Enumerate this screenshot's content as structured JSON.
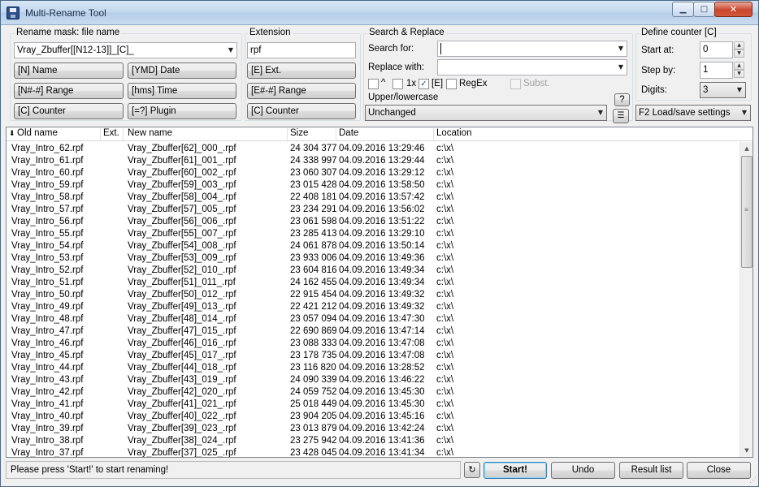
{
  "window": {
    "title": "Multi-Rename Tool"
  },
  "rename_mask": {
    "label": "Rename mask: file name",
    "value": "Vray_Zbuffer[[N12-13]]_[C]_",
    "buttons": [
      "[N]  Name",
      "[YMD]  Date",
      "[N#-#]  Range",
      "[hms]  Time",
      "[C]  Counter",
      "[=?]  Plugin"
    ]
  },
  "extension": {
    "label": "Extension",
    "value": "rpf",
    "buttons": [
      "[E]  Ext.",
      "[E#-#]  Range",
      "[C]  Counter"
    ]
  },
  "search_replace": {
    "label": "Search & Replace",
    "search_label": "Search for:",
    "search_value": "",
    "replace_label": "Replace with:",
    "replace_value": "",
    "opt_caret": "^",
    "opt_1x": "1x",
    "opt_e": "[E]",
    "opt_regex": "RegEx",
    "opt_subst": "Subst.",
    "case_label": "Upper/lowercase",
    "case_value": "Unchanged",
    "help_label": "?"
  },
  "counter": {
    "label": "Define counter [C]",
    "start_label": "Start at:",
    "start_value": "0",
    "step_label": "Step by:",
    "step_value": "1",
    "digits_label": "Digits:",
    "digits_value": "3",
    "load_save_label": "F2 Load/save settings"
  },
  "columns": [
    "Old name",
    "Ext.",
    "New name",
    "Size",
    "Date",
    "Location"
  ],
  "files": [
    {
      "old": "Vray_Intro_62.rpf",
      "new": "Vray_Zbuffer[62]_000_.rpf",
      "size": "24 304 377",
      "date": "04.09.2016 13:29:46",
      "loc": "c:\\x\\"
    },
    {
      "old": "Vray_Intro_61.rpf",
      "new": "Vray_Zbuffer[61]_001_.rpf",
      "size": "24 338 997",
      "date": "04.09.2016 13:29:44",
      "loc": "c:\\x\\"
    },
    {
      "old": "Vray_Intro_60.rpf",
      "new": "Vray_Zbuffer[60]_002_.rpf",
      "size": "23 060 307",
      "date": "04.09.2016 13:29:12",
      "loc": "c:\\x\\"
    },
    {
      "old": "Vray_Intro_59.rpf",
      "new": "Vray_Zbuffer[59]_003_.rpf",
      "size": "23 015 428",
      "date": "04.09.2016 13:58:50",
      "loc": "c:\\x\\"
    },
    {
      "old": "Vray_Intro_58.rpf",
      "new": "Vray_Zbuffer[58]_004_.rpf",
      "size": "22 408 181",
      "date": "04.09.2016 13:57:42",
      "loc": "c:\\x\\"
    },
    {
      "old": "Vray_Intro_57.rpf",
      "new": "Vray_Zbuffer[57]_005_.rpf",
      "size": "23 234 291",
      "date": "04.09.2016 13:56:02",
      "loc": "c:\\x\\"
    },
    {
      "old": "Vray_Intro_56.rpf",
      "new": "Vray_Zbuffer[56]_006_.rpf",
      "size": "23 061 598",
      "date": "04.09.2016 13:51:22",
      "loc": "c:\\x\\"
    },
    {
      "old": "Vray_Intro_55.rpf",
      "new": "Vray_Zbuffer[55]_007_.rpf",
      "size": "23 285 413",
      "date": "04.09.2016 13:29:10",
      "loc": "c:\\x\\"
    },
    {
      "old": "Vray_Intro_54.rpf",
      "new": "Vray_Zbuffer[54]_008_.rpf",
      "size": "24 061 878",
      "date": "04.09.2016 13:50:14",
      "loc": "c:\\x\\"
    },
    {
      "old": "Vray_Intro_53.rpf",
      "new": "Vray_Zbuffer[53]_009_.rpf",
      "size": "23 933 006",
      "date": "04.09.2016 13:49:36",
      "loc": "c:\\x\\"
    },
    {
      "old": "Vray_Intro_52.rpf",
      "new": "Vray_Zbuffer[52]_010_.rpf",
      "size": "23 604 816",
      "date": "04.09.2016 13:49:34",
      "loc": "c:\\x\\"
    },
    {
      "old": "Vray_Intro_51.rpf",
      "new": "Vray_Zbuffer[51]_011_.rpf",
      "size": "24 162 455",
      "date": "04.09.2016 13:49:34",
      "loc": "c:\\x\\"
    },
    {
      "old": "Vray_Intro_50.rpf",
      "new": "Vray_Zbuffer[50]_012_.rpf",
      "size": "22 915 454",
      "date": "04.09.2016 13:49:32",
      "loc": "c:\\x\\"
    },
    {
      "old": "Vray_Intro_49.rpf",
      "new": "Vray_Zbuffer[49]_013_.rpf",
      "size": "22 421 212",
      "date": "04.09.2016 13:49:32",
      "loc": "c:\\x\\"
    },
    {
      "old": "Vray_Intro_48.rpf",
      "new": "Vray_Zbuffer[48]_014_.rpf",
      "size": "23 057 094",
      "date": "04.09.2016 13:47:30",
      "loc": "c:\\x\\"
    },
    {
      "old": "Vray_Intro_47.rpf",
      "new": "Vray_Zbuffer[47]_015_.rpf",
      "size": "22 690 869",
      "date": "04.09.2016 13:47:14",
      "loc": "c:\\x\\"
    },
    {
      "old": "Vray_Intro_46.rpf",
      "new": "Vray_Zbuffer[46]_016_.rpf",
      "size": "23 088 333",
      "date": "04.09.2016 13:47:08",
      "loc": "c:\\x\\"
    },
    {
      "old": "Vray_Intro_45.rpf",
      "new": "Vray_Zbuffer[45]_017_.rpf",
      "size": "23 178 735",
      "date": "04.09.2016 13:47:08",
      "loc": "c:\\x\\"
    },
    {
      "old": "Vray_Intro_44.rpf",
      "new": "Vray_Zbuffer[44]_018_.rpf",
      "size": "23 116 820",
      "date": "04.09.2016 13:28:52",
      "loc": "c:\\x\\"
    },
    {
      "old": "Vray_Intro_43.rpf",
      "new": "Vray_Zbuffer[43]_019_.rpf",
      "size": "24 090 339",
      "date": "04.09.2016 13:46:22",
      "loc": "c:\\x\\"
    },
    {
      "old": "Vray_Intro_42.rpf",
      "new": "Vray_Zbuffer[42]_020_.rpf",
      "size": "24 059 752",
      "date": "04.09.2016 13:45:30",
      "loc": "c:\\x\\"
    },
    {
      "old": "Vray_Intro_41.rpf",
      "new": "Vray_Zbuffer[41]_021_.rpf",
      "size": "25 018 449",
      "date": "04.09.2016 13:45:30",
      "loc": "c:\\x\\"
    },
    {
      "old": "Vray_Intro_40.rpf",
      "new": "Vray_Zbuffer[40]_022_.rpf",
      "size": "23 904 205",
      "date": "04.09.2016 13:45:16",
      "loc": "c:\\x\\"
    },
    {
      "old": "Vray_Intro_39.rpf",
      "new": "Vray_Zbuffer[39]_023_.rpf",
      "size": "23 013 879",
      "date": "04.09.2016 13:42:24",
      "loc": "c:\\x\\"
    },
    {
      "old": "Vray_Intro_38.rpf",
      "new": "Vray_Zbuffer[38]_024_.rpf",
      "size": "23 275 942",
      "date": "04.09.2016 13:41:36",
      "loc": "c:\\x\\"
    },
    {
      "old": "Vray_Intro_37.rpf",
      "new": "Vray_Zbuffer[37]_025_.rpf",
      "size": "23 428 045",
      "date": "04.09.2016 13:41:34",
      "loc": "c:\\x\\"
    }
  ],
  "status": {
    "message": "Please press 'Start!' to start renaming!"
  },
  "actions": {
    "start": "Start!",
    "undo": "Undo",
    "result_list": "Result list",
    "close": "Close"
  }
}
